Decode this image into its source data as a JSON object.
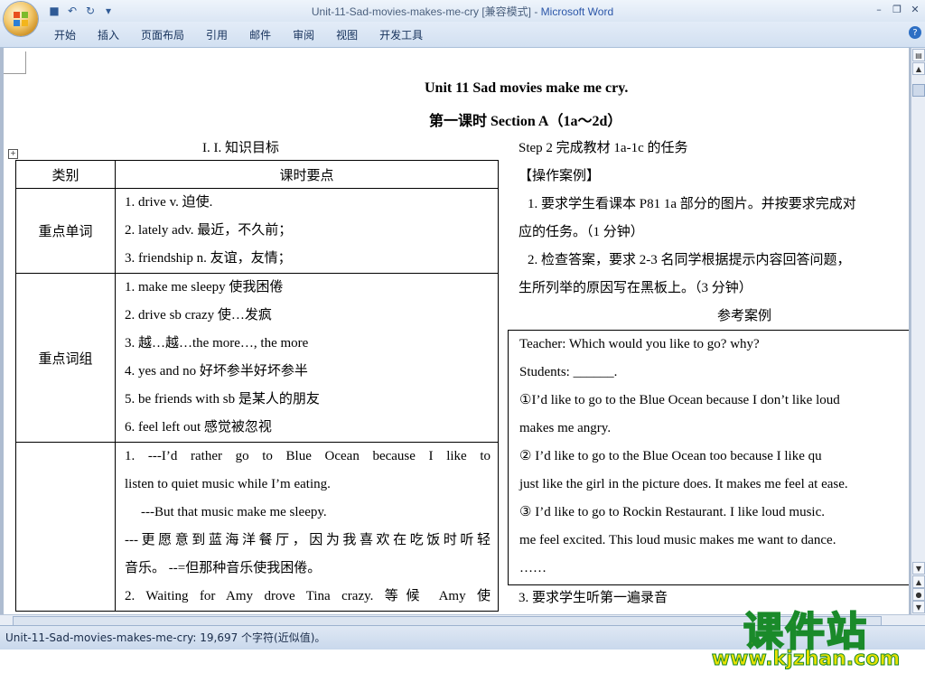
{
  "window": {
    "title": "Unit-11-Sad-movies-makes-me-cry [兼容模式] - ",
    "app_name": "Microsoft Word"
  },
  "ribbon": {
    "tabs": [
      "开始",
      "插入",
      "页面布局",
      "引用",
      "邮件",
      "审阅",
      "视图",
      "开发工具"
    ]
  },
  "document": {
    "title": "Unit 11 Sad movies make me cry.",
    "subtitle": "第一课时 Section A（1a～2d）",
    "knowledge_heading": "I. I. 知识目标",
    "table": {
      "headers": [
        "类别",
        "课时要点"
      ],
      "rows": [
        {
          "category": "重点单词",
          "items": [
            "1. drive v. 迫使.",
            "2. lately adv. 最近，不久前；",
            "3. friendship n. 友谊，友情；"
          ]
        },
        {
          "category": "重点词组",
          "items": [
            "1. make me sleepy 使我困倦",
            "2. drive sb crazy 使…发疯",
            "3. 越…越…the more…, the more",
            "4. yes and no 好坏参半好坏参半",
            "5. be friends with sb 是某人的朋友",
            "6. feel left out 感觉被忽视"
          ]
        },
        {
          "category": "",
          "items": [
            "1. ---I’d rather go to Blue Ocean because I like to",
            "listen to quiet music while I’m eating.",
            "---But that music make me sleepy.",
            "---更愿意到蓝海洋餐厅，因为我喜欢在吃饭时听轻",
            "音乐。 --=但那种音乐使我困倦。",
            "2. Waiting for Amy drove Tina crazy. 等候 Amy 使"
          ]
        }
      ]
    },
    "right": {
      "step2": "Step 2 完成教材 1a-1c 的任务",
      "case_heading": "【操作案例】",
      "lines": [
        "1. 要求学生看课本 P81 1a 部分的图片。并按要求完成对",
        "应的任务。（1 分钟）",
        "2. 检查答案，要求 2-3 名同学根据提示内容回答问题，",
        "生所列举的原因写在黑板上。（3 分钟）"
      ],
      "reference_heading": "参考案例",
      "box_lines": [
        "Teacher: Which would you like to go? why?",
        "Students: ______.",
        "①I’d like to go to the Blue Ocean because I don’t like loud",
        "makes me angry.",
        "② I’d like to go to the Blue Ocean too because I like qu",
        "just like the girl in the picture does. It makes me feel at ease.",
        "③ I’d like to go to Rockin Restaurant. I like loud music.",
        "me feel excited. This loud music makes me want to dance.",
        "……"
      ],
      "after_box": "3. 要求学生听第一遍录音"
    }
  },
  "watermark": {
    "title": "课件站",
    "url": "www.kjzhan.com"
  },
  "status": {
    "text": "Unit-11-Sad-movies-makes-me-cry: 19,697 个字符(近似值)。"
  }
}
